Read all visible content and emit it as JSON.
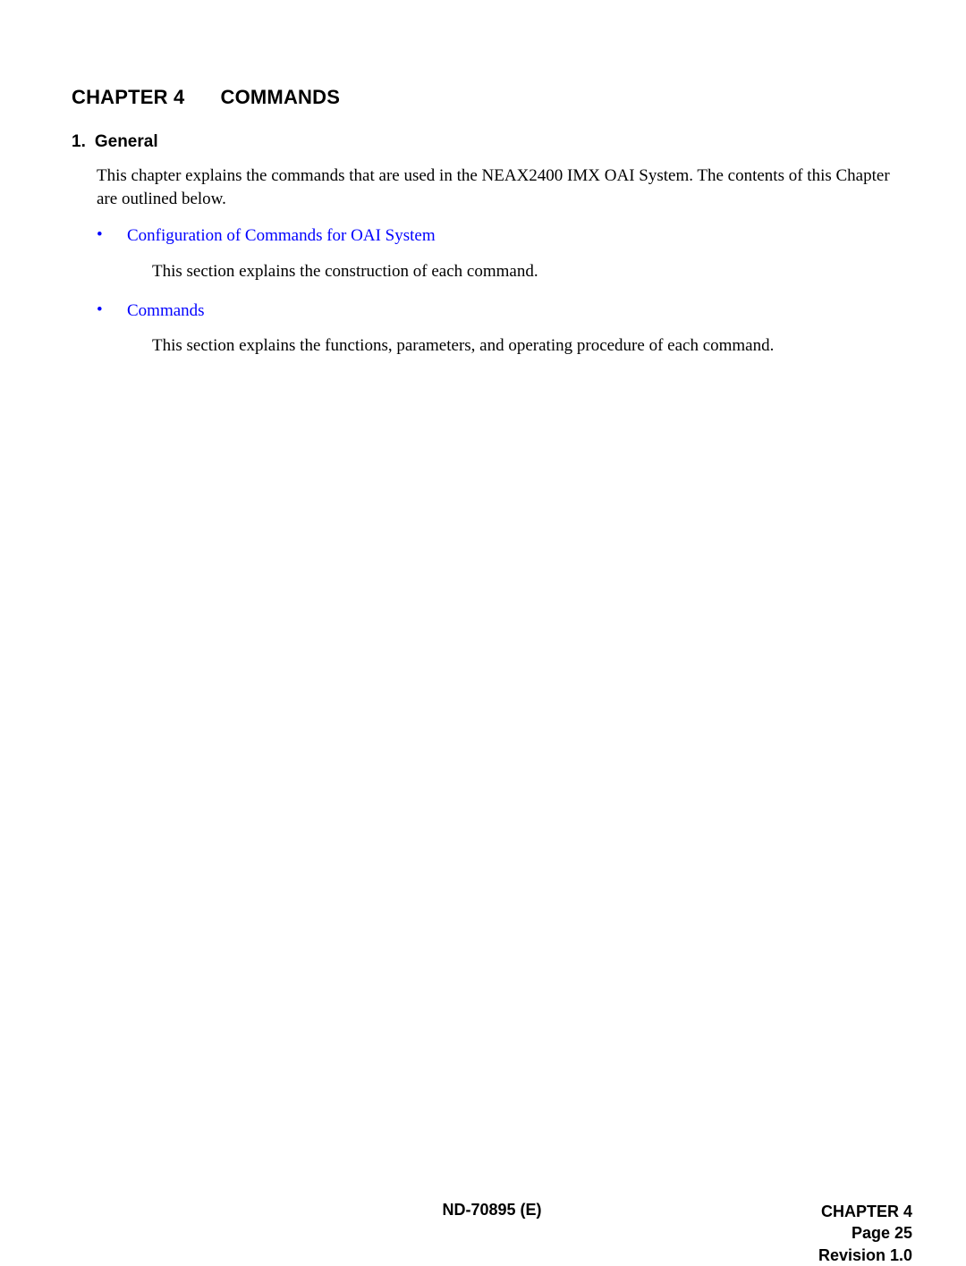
{
  "chapter": {
    "label_prefix": "CHAPTER 4",
    "label_title": "COMMANDS"
  },
  "section1": {
    "number": "1.",
    "title": "General",
    "intro": "This chapter explains the commands that are used in the NEAX2400 IMX OAI System. The contents of this Chapter are outlined below."
  },
  "bullets": [
    {
      "link": "Configuration of Commands for OAI System",
      "desc": "This section explains the construction of each command."
    },
    {
      "link": "Commands",
      "desc": "This section explains the functions, parameters, and operating procedure of each command."
    }
  ],
  "footer": {
    "center": "ND-70895 (E)",
    "right_line1": "CHAPTER 4",
    "right_line2": "Page 25",
    "right_line3": "Revision 1.0"
  }
}
